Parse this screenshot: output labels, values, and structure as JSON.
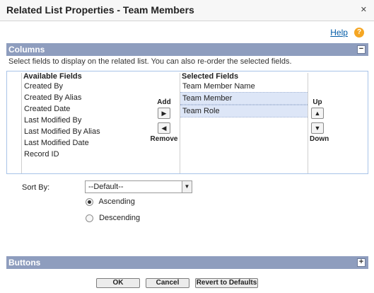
{
  "dialog": {
    "title": "Related List Properties - Team Members",
    "close_glyph": "✕"
  },
  "help": {
    "label": "Help",
    "icon_glyph": "?"
  },
  "columns": {
    "title": "Columns",
    "toggle_glyph": "−",
    "instructions": "Select fields to display on the related list. You can also re-order the selected fields.",
    "available": {
      "header": "Available Fields",
      "items": [
        "Created By",
        "Created By Alias",
        "Created Date",
        "Last Modified By",
        "Last Modified By Alias",
        "Last Modified Date",
        "Record ID"
      ]
    },
    "selected": {
      "header": "Selected Fields",
      "items": [
        "Team Member Name",
        "Team Member",
        "Team Role"
      ]
    },
    "add_label": "Add",
    "remove_label": "Remove",
    "up_label": "Up",
    "down_label": "Down",
    "add_glyph": "▶",
    "remove_glyph": "◀",
    "up_glyph": "▲",
    "down_glyph": "▼"
  },
  "sort": {
    "label": "Sort By:",
    "value": "--Default--",
    "arrow_glyph": "▼",
    "ascending_label": "Ascending",
    "descending_label": "Descending",
    "selected_order": "Ascending"
  },
  "buttons_section": {
    "title": "Buttons",
    "toggle_glyph": "+"
  },
  "footer": {
    "ok_label": "OK",
    "cancel_label": "Cancel",
    "revert_label": "Revert to Defaults"
  }
}
